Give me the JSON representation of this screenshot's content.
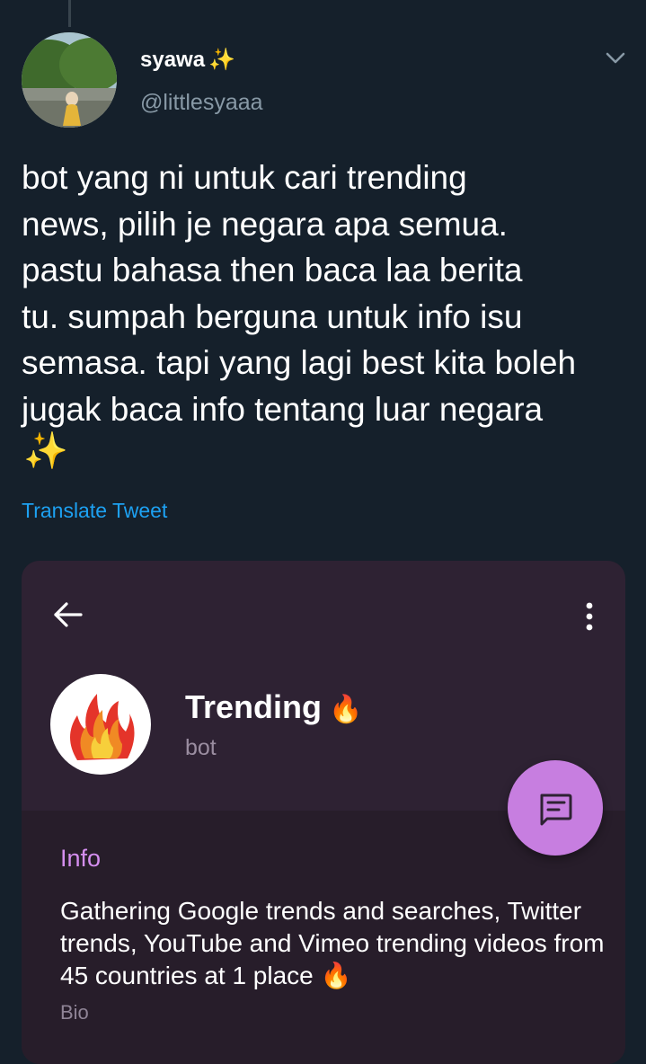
{
  "tweet": {
    "author": {
      "name": "syawa",
      "name_emoji": "✨",
      "handle": "@littlesyaaa"
    },
    "text": "bot yang ni untuk cari trending\nnews, pilih je negara apa semua.\npastu bahasa then baca laa berita\ntu. sumpah berguna untuk info isu\nsemasa. tapi yang lagi best kita boleh\njugak baca info tentang luar negara",
    "text_emoji": "✨",
    "translate_label": "Translate Tweet",
    "menu_icon": "chevron-down-icon"
  },
  "embedded_screenshot": {
    "header": {
      "back_icon": "arrow-left-icon",
      "menu_icon": "more-vertical-icon"
    },
    "profile": {
      "name": "Trending",
      "name_emoji": "🔥",
      "type": "bot",
      "avatar_icon": "flame-logo"
    },
    "fab_icon": "message-icon",
    "info": {
      "section_label": "Info",
      "bio": "Gathering Google trends and searches, Twitter trends, YouTube and Vimeo trending videos from 45 countries at 1 place",
      "bio_emoji": "🔥",
      "bio_label": "Bio"
    }
  },
  "colors": {
    "background": "#15202b",
    "link": "#1da1f2",
    "secondary_text": "#8899a6",
    "card_bg": "#2e2233",
    "accent_purple": "#c77ee0",
    "info_label": "#d58ef0"
  }
}
